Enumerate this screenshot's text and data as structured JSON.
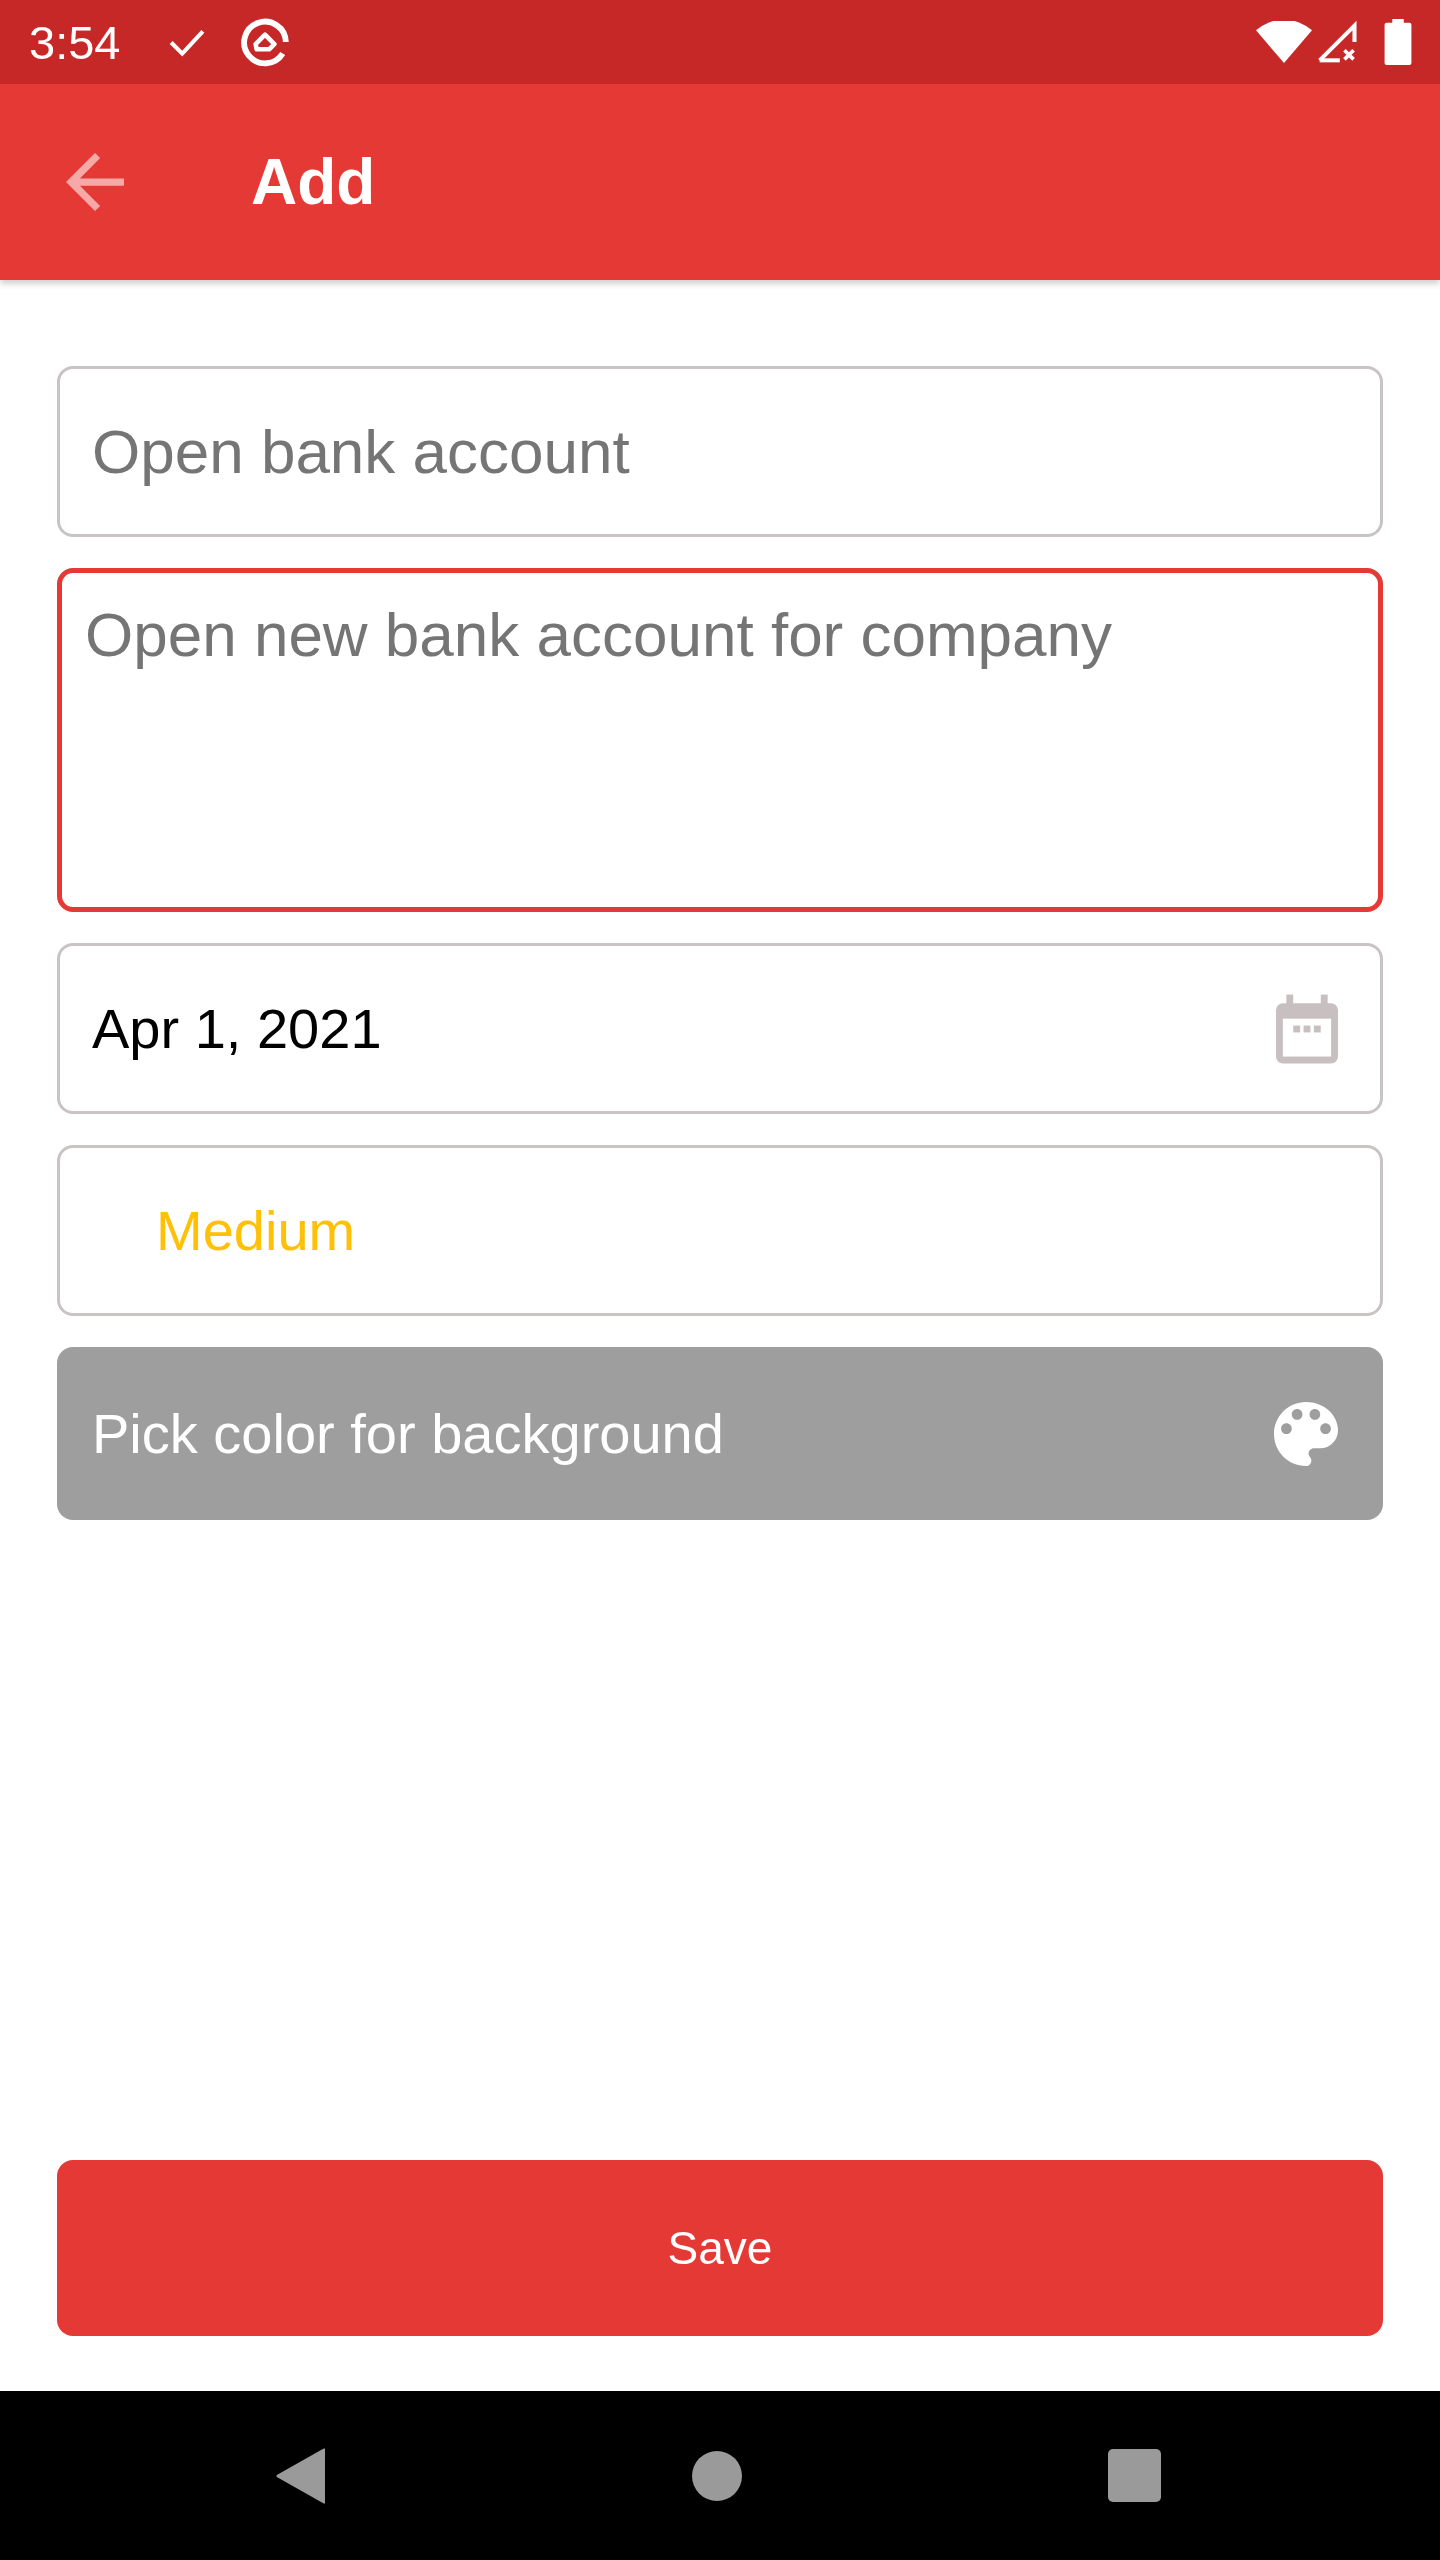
{
  "status_bar": {
    "time": "3:54"
  },
  "app_bar": {
    "title": "Add"
  },
  "form": {
    "fields": [
      {
        "kind": "text",
        "value": "Open bank account",
        "focused": false
      },
      {
        "kind": "multiline",
        "value": "Open new bank account for company",
        "focused": true
      },
      {
        "kind": "date",
        "value": "Apr 1, 2021",
        "focused": false
      },
      {
        "kind": "dropdown",
        "value": "Medium",
        "focused": false,
        "color": "#ffc107"
      }
    ],
    "color_button": {
      "label": "Pick color for background"
    }
  },
  "save_button": {
    "label": "Save"
  }
}
